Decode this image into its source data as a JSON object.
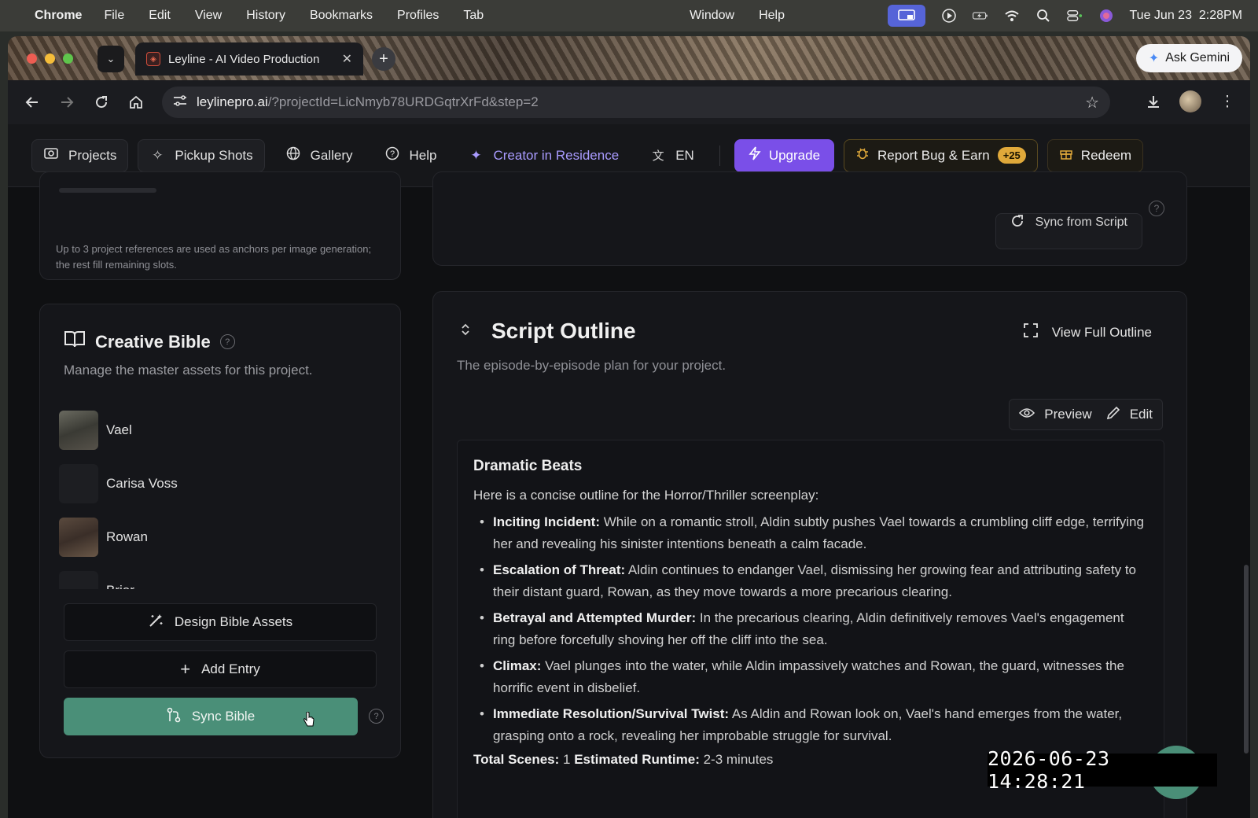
{
  "menubar": {
    "app": "Chrome",
    "items": [
      "File",
      "Edit",
      "View",
      "History",
      "Bookmarks",
      "Profiles",
      "Tab",
      "Window",
      "Help"
    ],
    "clock": "Tue Jun 23  2:28PM"
  },
  "browser": {
    "tab_title": "Leyline - AI Video Production",
    "ask_gemini": "Ask Gemini",
    "url_host": "leylinepro.ai",
    "url_path": "/?projectId=LicNmyb78URDGqtrXrFd&step=2"
  },
  "nav": {
    "projects": "Projects",
    "pickup_shots": "Pickup Shots",
    "gallery": "Gallery",
    "help": "Help",
    "creator": "Creator in Residence",
    "language": "EN",
    "upgrade": "Upgrade",
    "report_bug": "Report Bug & Earn",
    "report_badge": "+25",
    "redeem": "Redeem"
  },
  "references": {
    "note": "Up to 3 project references are used as anchors per image generation; the rest fill remaining slots."
  },
  "sync_from_script": "Sync from Script",
  "bible": {
    "title": "Creative Bible",
    "description": "Manage the master assets for this project.",
    "entries": [
      "Vael",
      "Carisa Voss",
      "Rowan",
      "Brior"
    ],
    "design_button": "Design Bible Assets",
    "add_button": "Add Entry",
    "sync_button": "Sync Bible"
  },
  "outline": {
    "title": "Script Outline",
    "subtitle": "The episode-by-episode plan for your project.",
    "view_full": "View Full Outline",
    "preview": "Preview",
    "edit": "Edit",
    "heading": "Dramatic Beats",
    "intro": "Here is a concise outline for the Horror/Thriller screenplay:",
    "beats": [
      {
        "label": "Inciting Incident:",
        "text": " While on a romantic stroll, Aldin subtly pushes Vael towards a crumbling cliff edge, terrifying her and revealing his sinister intentions beneath a calm facade."
      },
      {
        "label": "Escalation of Threat:",
        "text": " Aldin continues to endanger Vael, dismissing her growing fear and attributing safety to their distant guard, Rowan, as they move towards a more precarious clearing."
      },
      {
        "label": "Betrayal and Attempted Murder:",
        "text": " In the precarious clearing, Aldin definitively removes Vael's engagement ring before forcefully shoving her off the cliff into the sea."
      },
      {
        "label": "Climax:",
        "text": " Vael plunges into the water, while Aldin impassively watches and Rowan, the guard, witnesses the horrific event in disbelief."
      },
      {
        "label": "Immediate Resolution/Survival Twist:",
        "text": " As Aldin and Rowan look on, Vael's hand emerges from the water, grasping onto a rock, revealing her improbable struggle for survival."
      }
    ],
    "total_scenes_label": "Total Scenes:",
    "total_scenes_value": "1",
    "runtime_label": "Estimated Runtime:",
    "runtime_value": "2-3 minutes"
  },
  "timestamp": "2026-06-23 14:28:21",
  "colors": {
    "accent_purple": "#7a4fe8",
    "accent_green": "#4a8f78",
    "badge_gold": "#e0a93a"
  }
}
